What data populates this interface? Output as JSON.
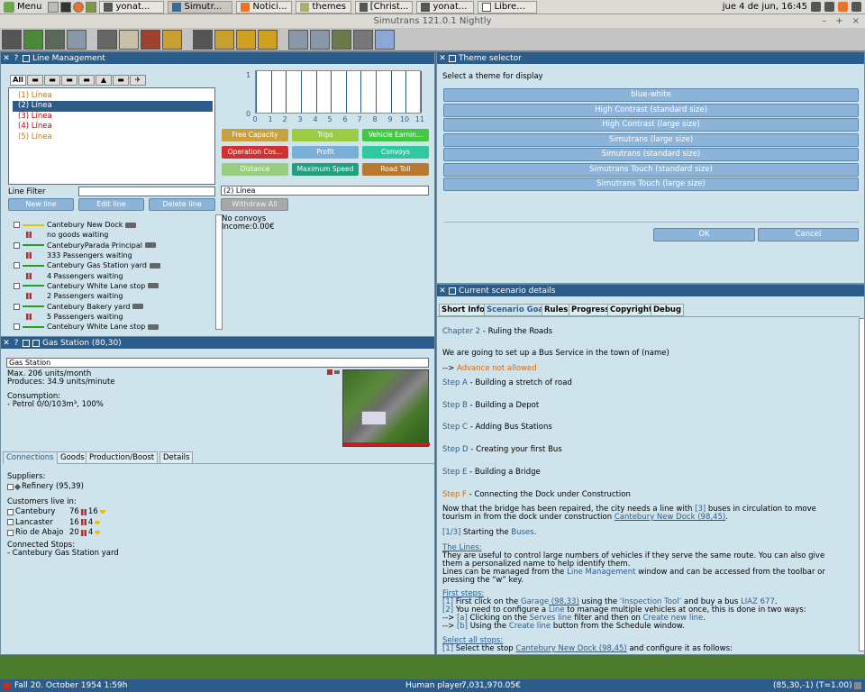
{
  "os_panel": {
    "menu_label": "Menu",
    "tasks": [
      "yonat...",
      "Simutr...",
      "Notici...",
      "themes",
      "[Christ...",
      "yonat...",
      "Libre..."
    ],
    "clock": "jue 4 de jun, 16:45"
  },
  "titlebar": {
    "title": "Simutrans 121.0.1 Nightly",
    "clock": "jue 4 de jun, 16:45",
    "minimize": "–",
    "maximize": "+",
    "close": "×"
  },
  "line_management": {
    "title": "Line Management",
    "filter_tabs": [
      "All"
    ],
    "lines": [
      {
        "label": "(1) Línea",
        "color": "#c87800"
      },
      {
        "label": "(2) Línea",
        "color": "#ffffff",
        "selected": true
      },
      {
        "label": "(3) Línea",
        "color": "#c00000"
      },
      {
        "label": "(4) Línea",
        "color": "#c00000"
      },
      {
        "label": "(5) Línea",
        "color": "#c87800"
      }
    ],
    "chart": {
      "y_max": "1",
      "y_min": "0",
      "x_ticks": [
        "0",
        "1",
        "2",
        "3",
        "4",
        "5",
        "6",
        "7",
        "8",
        "9",
        "10",
        "11"
      ]
    },
    "stat_buttons": [
      {
        "label": "Free Capacity",
        "color": "#c8a040"
      },
      {
        "label": "Trips",
        "color": "#9acc44"
      },
      {
        "label": "Vehicle Earnin...",
        "color": "#44c844"
      },
      {
        "label": "Operation Cos...",
        "color": "#d03030"
      },
      {
        "label": "Profit",
        "color": "#7ab0d8"
      },
      {
        "label": "Convoys",
        "color": "#30c8a0"
      },
      {
        "label": "Distance",
        "color": "#98cc80"
      },
      {
        "label": "Maximum Speed",
        "color": "#20a080"
      },
      {
        "label": "Road Toll",
        "color": "#b87830"
      }
    ],
    "line_filter_label": "Line Filter",
    "new_line": "New line",
    "edit_line": "Edit line",
    "delete_line": "Delete line",
    "selected_line_name": "(2) Línea",
    "withdraw_all": "Withdraw All",
    "no_convoys": "No convoys",
    "income": "Income:0.00€",
    "stops": [
      {
        "name": "Cantebury New Dock",
        "detail": "no goods waiting",
        "bar": "#e8c000"
      },
      {
        "name": "CanteburyParada Principal",
        "detail": "333 Passengers waiting",
        "bar": "#20a020"
      },
      {
        "name": "Cantebury Gas Station yard",
        "detail": "4 Passengers waiting",
        "bar": "#20a020"
      },
      {
        "name": "Cantebury White Lane stop",
        "detail": "2 Passengers waiting",
        "bar": "#20a020"
      },
      {
        "name": "Cantebury Bakery yard",
        "detail": "5 Passengers waiting",
        "bar": "#20a020"
      },
      {
        "name": "Cantebury White Lane stop",
        "detail": "",
        "bar": "#20a020"
      }
    ]
  },
  "gas_station": {
    "title": "Gas Station (80,30)",
    "name": "Gas Station",
    "max": "Max. 206 units/month",
    "produces": "Produces: 34.9 units/minute",
    "consumption_label": "Consumption:",
    "consumption": " - Petrol 0/0/103m³, 100%",
    "tabs": [
      "Connections",
      "Goods",
      "Production/Boost",
      "Details"
    ],
    "suppliers_label": "Suppliers:",
    "supplier": "Refinery (95,39)",
    "customers_label": "Customers live in:",
    "customers": [
      {
        "name": "Cantebury",
        "a": "76",
        "b": "16"
      },
      {
        "name": "Lancaster",
        "a": "16",
        "b": "4"
      },
      {
        "name": "Rio de Abajo",
        "a": "20",
        "b": "4"
      }
    ],
    "connected_label": "Connected Stops:",
    "connected_stop": " - Cantebury Gas Station yard"
  },
  "theme_selector": {
    "title": "Theme selector",
    "prompt": "Select a theme for display",
    "themes": [
      "blue-white",
      "High Contrast (standard size)",
      "High Contrast (large size)",
      "Simutrans (large size)",
      "Simutrans (standard size)",
      "Simutrans Touch (standard size)",
      "Simutrans Touch (large size)"
    ],
    "ok": "OK",
    "cancel": "Cancel"
  },
  "scenario": {
    "title": "Current scenario details",
    "tabs": [
      "Short Info",
      "Scenario Goal",
      "Rules",
      "Progress",
      "Copyright",
      "Debug"
    ],
    "chapter_label": "Chapter 2",
    "chapter_name": " - Ruling the Roads",
    "intro": "We are going to set up a Bus Service in the town of (name)",
    "advance_prefix": "--> ",
    "advance": "Advance not allowed",
    "steps": [
      {
        "label": "Step A",
        "text": " - Building a stretch of road",
        "current": false
      },
      {
        "label": "Step B",
        "text": " - Building a Depot",
        "current": false
      },
      {
        "label": "Step C",
        "text": " - Adding Bus Stations",
        "current": false
      },
      {
        "label": "Step D",
        "text": " - Creating your first Bus",
        "current": false
      },
      {
        "label": "Step E",
        "text": " - Building a Bridge",
        "current": false
      },
      {
        "label": "Step F",
        "text": " - Connecting the Dock under Construction",
        "current": true
      }
    ],
    "para1_a": "Now that the bridge has been repaired, the city  needs a line with ",
    "para1_num": "[3]",
    "para1_b": " buses in circulation to move",
    "para1_c": "tourism in from the dock under construction ",
    "para1_link": "Cantebury New Dock (98,45)",
    "para1_d": ".",
    "starting_prefix": "[1/3]",
    "starting_text": " Starting the ",
    "starting_link": "Buses",
    "starting_end": ".",
    "lines_heading": "The Lines:",
    "lines_1": "They are useful to control large numbers of vehicles if they serve the same route. You can also give",
    "lines_2": "them a personalized name to help identify them.",
    "lines_3a": "Lines can be managed from the ",
    "lines_3link": "Line Management",
    "lines_3b": " window and can be accessed from the toolbar or",
    "lines_4": "pressing the “w” key.",
    "first_heading": "First steps:",
    "fs1_num": "[1]",
    "fs1_a": " First click on the ",
    "fs1_link1": "Garage",
    "fs1_coord": "  (98,33)",
    "fs1_b": " using the ",
    "fs1_link2": "‘Inspection Tool’",
    "fs1_c": " and buy a bus ",
    "fs1_link3": "LIAZ 677",
    "fs1_d": ".",
    "fs2_num": "[2]",
    "fs2_a": " You need to configure a ",
    "fs2_link": "Line",
    "fs2_b": " to manage multiple vehicles at once, this is done in two ways:",
    "fs3_prefix": "--> ",
    "fs3_num": "[a]",
    "fs3_a": " Clicking on the ",
    "fs3_link1": "Serves line",
    "fs3_b": " filter and then on ",
    "fs3_link2": "Create new line",
    "fs3_c": ".",
    "fs4_prefix": "--> ",
    "fs4_num": "[b]",
    "fs4_a": " Using the ",
    "fs4_link": "Create line",
    "fs4_b": " button from the Schedule window.",
    "select_heading": "Select all stops:",
    "ss1_num": "[1]",
    "ss1_a": " Select the stop ",
    "ss1_link": "Cantebury New Dock (98,45)",
    "ss1_b": " and configure it as follows:"
  },
  "statusbar": {
    "date": "Fall 20. October 1954  1:59h",
    "player": "Human player",
    "money": "7,031,970.05€",
    "position": "(85,30,-1) (T=1.00)"
  }
}
